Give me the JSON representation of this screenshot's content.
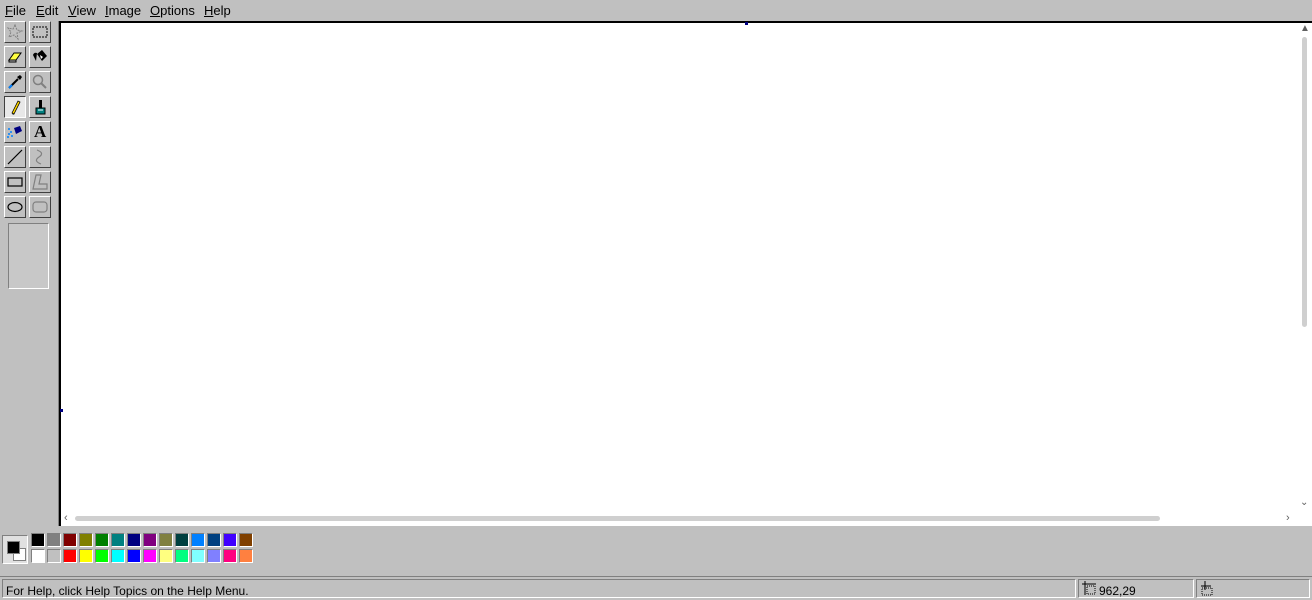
{
  "menu": {
    "items": [
      {
        "key": "F",
        "rest": "ile"
      },
      {
        "key": "E",
        "rest": "dit"
      },
      {
        "key": "V",
        "rest": "iew"
      },
      {
        "key": "I",
        "rest": "mage"
      },
      {
        "key": "O",
        "rest": "ptions"
      },
      {
        "key": "H",
        "rest": "elp"
      }
    ]
  },
  "toolbox": {
    "tools": [
      {
        "icon": "free-form-select-icon",
        "pressed": false
      },
      {
        "icon": "rect-select-icon",
        "pressed": false
      },
      {
        "icon": "eraser-icon",
        "pressed": false
      },
      {
        "icon": "fill-bucket-icon",
        "pressed": false
      },
      {
        "icon": "color-picker-icon",
        "pressed": false
      },
      {
        "icon": "magnifier-icon",
        "pressed": false
      },
      {
        "icon": "pencil-icon",
        "pressed": true
      },
      {
        "icon": "brush-icon",
        "pressed": false
      },
      {
        "icon": "airbrush-icon",
        "pressed": false
      },
      {
        "icon": "text-icon",
        "pressed": false
      },
      {
        "icon": "line-icon",
        "pressed": false
      },
      {
        "icon": "curve-icon",
        "pressed": false
      },
      {
        "icon": "rectangle-icon",
        "pressed": false
      },
      {
        "icon": "polygon-icon",
        "pressed": false
      },
      {
        "icon": "ellipse-icon",
        "pressed": false
      },
      {
        "icon": "rounded-rect-icon",
        "pressed": false
      }
    ],
    "text_tool_glyph": "A"
  },
  "palette": {
    "foreground": "#000000",
    "background": "#ffffff",
    "top_row": [
      "#000000",
      "#808080",
      "#800000",
      "#808000",
      "#008000",
      "#008080",
      "#000080",
      "#800080",
      "#808040",
      "#004040",
      "#0080ff",
      "#004080",
      "#4000ff",
      "#804000"
    ],
    "bottom_row": [
      "#ffffff",
      "#c0c0c0",
      "#ff0000",
      "#ffff00",
      "#00ff00",
      "#00ffff",
      "#0000ff",
      "#ff00ff",
      "#ffff80",
      "#00ff80",
      "#80ffff",
      "#8080ff",
      "#ff0080",
      "#ff8040"
    ]
  },
  "status": {
    "help_text": "For Help, click Help Topics on the Help Menu.",
    "position": "962,29",
    "size": ""
  }
}
